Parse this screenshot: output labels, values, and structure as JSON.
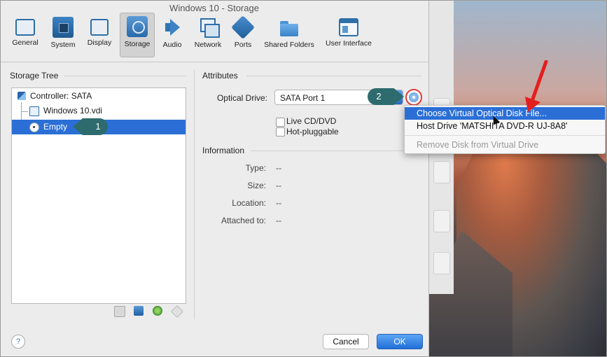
{
  "window": {
    "title": "Windows 10 - Storage"
  },
  "toolbar": {
    "items": [
      {
        "label": "General",
        "icon": "monitor-icon"
      },
      {
        "label": "System",
        "icon": "chip-icon"
      },
      {
        "label": "Display",
        "icon": "display-icon"
      },
      {
        "label": "Storage",
        "icon": "disk-icon",
        "active": true
      },
      {
        "label": "Audio",
        "icon": "speaker-icon"
      },
      {
        "label": "Network",
        "icon": "network-icon"
      },
      {
        "label": "Ports",
        "icon": "ports-icon"
      },
      {
        "label": "Shared Folders",
        "icon": "folder-icon"
      },
      {
        "label": "User Interface",
        "icon": "window-icon"
      }
    ]
  },
  "storage_tree": {
    "heading": "Storage Tree",
    "controller": "Controller: SATA",
    "disk": "Windows 10.vdi",
    "optical": "Empty"
  },
  "attributes": {
    "heading": "Attributes",
    "optical_drive_label": "Optical Drive:",
    "optical_drive_value": "SATA Port 1",
    "live_cd_label": "Live CD/DVD",
    "hot_pluggable_label": "Hot-pluggable"
  },
  "information": {
    "heading": "Information",
    "type_label": "Type:",
    "type_value": "--",
    "size_label": "Size:",
    "size_value": "--",
    "location_label": "Location:",
    "location_value": "--",
    "attached_label": "Attached to:",
    "attached_value": "--"
  },
  "menu": {
    "items": [
      {
        "label": "Choose Virtual Optical Disk File...",
        "state": "highlighted"
      },
      {
        "label": "Host Drive 'MATSHITA DVD-R   UJ-8A8'",
        "state": "normal"
      },
      {
        "label": "Remove Disk from Virtual Drive",
        "state": "disabled"
      }
    ]
  },
  "callouts": {
    "one": "1",
    "two": "2"
  },
  "buttons": {
    "help": "?",
    "cancel": "Cancel",
    "ok": "OK"
  },
  "colors": {
    "accent": "#2b6fd6",
    "callout": "#2d6b6e",
    "highlight_ring": "#e23b35"
  }
}
